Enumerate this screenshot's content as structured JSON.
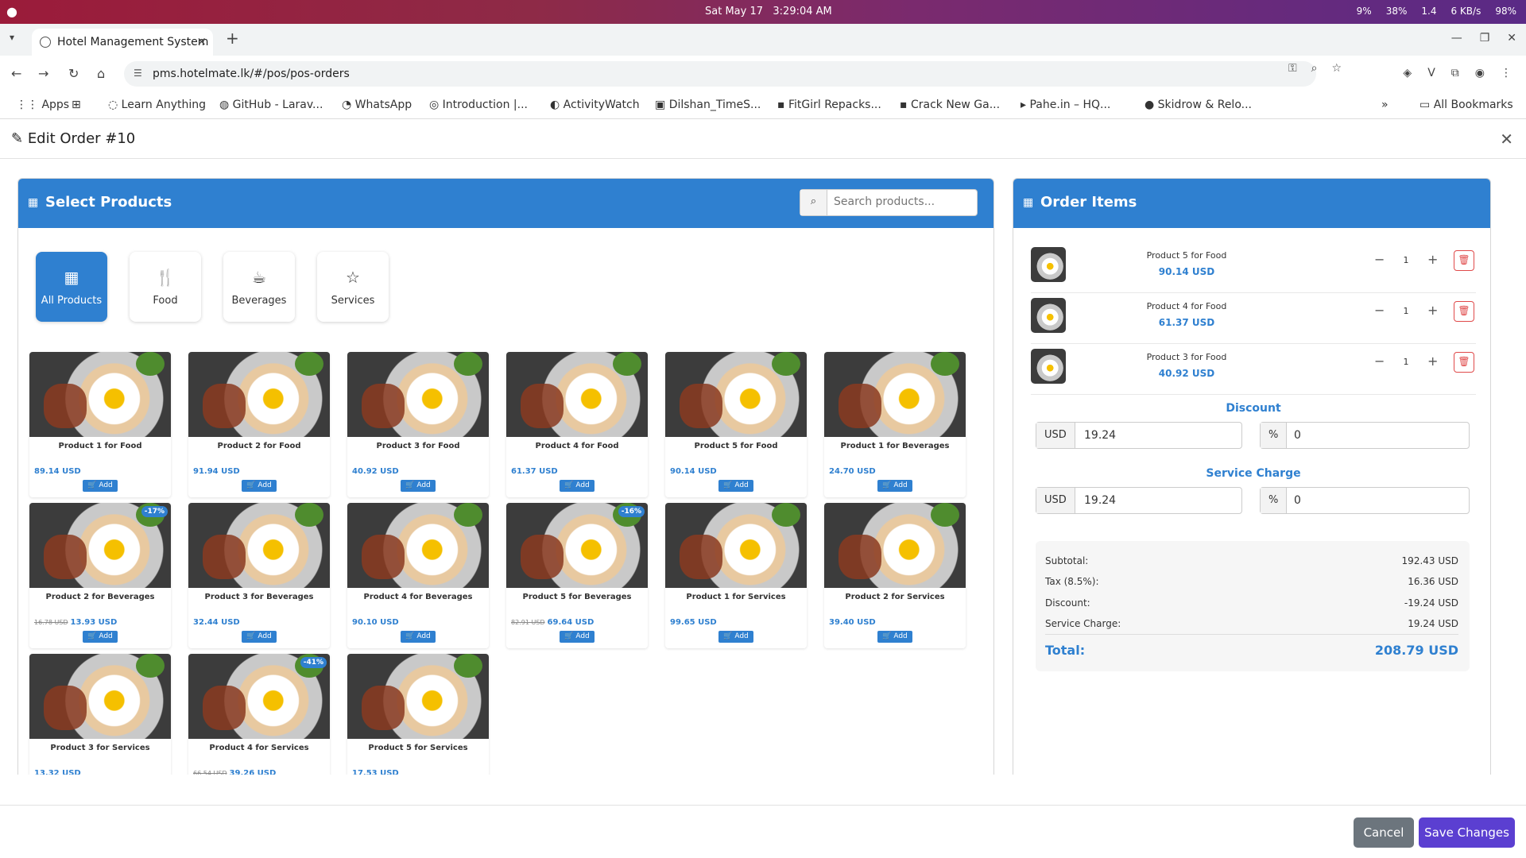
{
  "system_bar": {
    "date": "Sat May 17",
    "time": "3:29:04 AM",
    "cpu": "9%",
    "mem": "38%",
    "load": "1.4",
    "net": "6 KB/s",
    "battery": "98%"
  },
  "browser": {
    "tab_title": "Hotel Management System",
    "url": "pms.hotelmate.lk/#/pos/pos-orders",
    "bookmarks": [
      "Apps",
      "Learn Anything",
      "GitHub - Larav...",
      "WhatsApp",
      "Introduction |...",
      "ActivityWatch",
      "Dilshan_TimeS...",
      "FitGirl Repacks...",
      "Crack New Ga...",
      "Pahe.in – HQ...",
      "Skidrow & Relo...",
      "All Bookmarks"
    ]
  },
  "modal": {
    "title": "Edit Order #10"
  },
  "products_panel": {
    "title": "Select Products",
    "search_placeholder": "Search products...",
    "categories": [
      {
        "label": "All Products",
        "icon": "grid-icon",
        "active": true
      },
      {
        "label": "Food",
        "icon": "food-icon",
        "active": false
      },
      {
        "label": "Beverages",
        "icon": "cup-icon",
        "active": false
      },
      {
        "label": "Services",
        "icon": "star-icon",
        "active": false
      }
    ],
    "add_label": "Add",
    "products": [
      {
        "name": "Product 1 for Food",
        "price": "89.14 USD",
        "old_price": "",
        "discount": ""
      },
      {
        "name": "Product 2 for Food",
        "price": "91.94 USD",
        "old_price": "",
        "discount": ""
      },
      {
        "name": "Product 3 for Food",
        "price": "40.92 USD",
        "old_price": "",
        "discount": ""
      },
      {
        "name": "Product 4 for Food",
        "price": "61.37 USD",
        "old_price": "",
        "discount": ""
      },
      {
        "name": "Product 5 for Food",
        "price": "90.14 USD",
        "old_price": "",
        "discount": ""
      },
      {
        "name": "Product 1 for Beverages",
        "price": "24.70 USD",
        "old_price": "",
        "discount": ""
      },
      {
        "name": "Product 2 for Beverages",
        "price": "13.93 USD",
        "old_price": "16.78 USD",
        "discount": "-17%"
      },
      {
        "name": "Product 3 for Beverages",
        "price": "32.44 USD",
        "old_price": "",
        "discount": ""
      },
      {
        "name": "Product 4 for Beverages",
        "price": "90.10 USD",
        "old_price": "",
        "discount": ""
      },
      {
        "name": "Product 5 for Beverages",
        "price": "69.64 USD",
        "old_price": "82.91 USD",
        "discount": "-16%"
      },
      {
        "name": "Product 1 for Services",
        "price": "99.65 USD",
        "old_price": "",
        "discount": ""
      },
      {
        "name": "Product 2 for Services",
        "price": "39.40 USD",
        "old_price": "",
        "discount": ""
      },
      {
        "name": "Product 3 for Services",
        "price": "13.32 USD",
        "old_price": "",
        "discount": ""
      },
      {
        "name": "Product 4 for Services",
        "price": "39.26 USD",
        "old_price": "66.54 USD",
        "discount": "-41%"
      },
      {
        "name": "Product 5 for Services",
        "price": "17.53 USD",
        "old_price": "",
        "discount": ""
      }
    ]
  },
  "order_panel": {
    "title": "Order Items",
    "items": [
      {
        "name": "Product 5 for Food",
        "price": "90.14 USD",
        "qty": "1"
      },
      {
        "name": "Product 4 for Food",
        "price": "61.37 USD",
        "qty": "1"
      },
      {
        "name": "Product 3 for Food",
        "price": "40.92 USD",
        "qty": "1"
      }
    ],
    "discount": {
      "label": "Discount",
      "currency": "USD",
      "amount": "19.24",
      "pct_sign": "%",
      "pct": "0"
    },
    "service": {
      "label": "Service Charge",
      "currency": "USD",
      "amount": "19.24",
      "pct_sign": "%",
      "pct": "0"
    },
    "summary": {
      "subtotal_label": "Subtotal:",
      "subtotal": "192.43 USD",
      "tax_label": "Tax (8.5%):",
      "tax": "16.36 USD",
      "discount_label": "Discount:",
      "discount": "-19.24 USD",
      "service_label": "Service Charge:",
      "service": "19.24 USD",
      "total_label": "Total:",
      "total": "208.79 USD"
    }
  },
  "footer": {
    "cancel": "Cancel",
    "save": "Save Changes"
  },
  "colors": {
    "primary": "#2f80d0",
    "save": "#5b3fd1",
    "cancel": "#6c757d",
    "danger": "#e04a4a"
  }
}
